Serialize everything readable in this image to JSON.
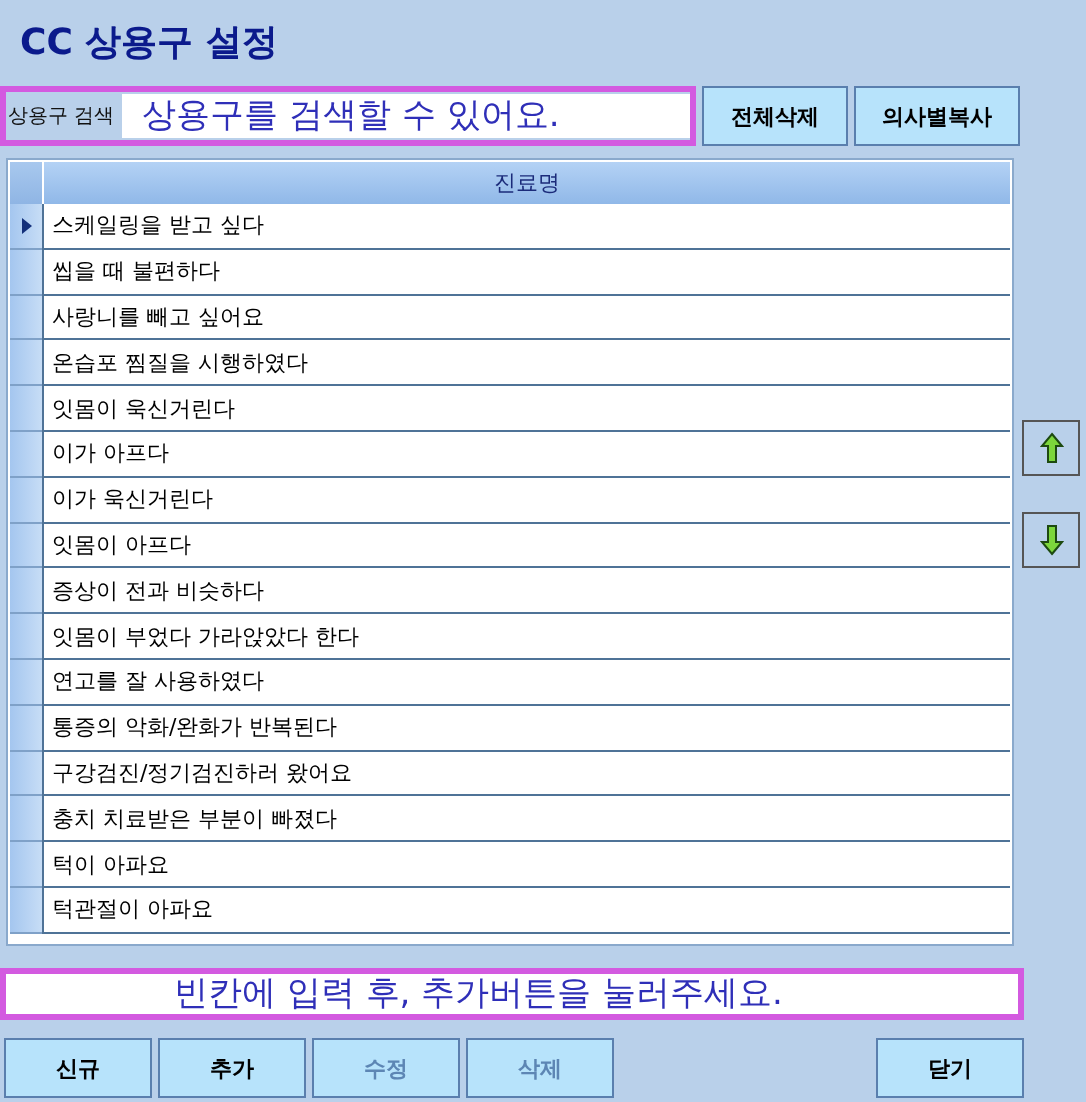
{
  "title": "CC 상용구 설정",
  "search": {
    "label": "상용구 검색",
    "placeholder": "상용구를 검색할 수 있어요."
  },
  "top_buttons": [
    "전체삭제",
    "의사별복사"
  ],
  "table": {
    "columns": [
      "진료명"
    ],
    "rows": [
      {
        "text": "스케일링을 받고 싶다",
        "selected": true
      },
      {
        "text": "씹을 때 불편하다",
        "selected": false
      },
      {
        "text": "사랑니를 빼고 싶어요",
        "selected": false
      },
      {
        "text": "온습포 찜질을 시행하였다",
        "selected": false
      },
      {
        "text": "잇몸이 욱신거린다",
        "selected": false
      },
      {
        "text": "이가 아프다",
        "selected": false
      },
      {
        "text": "이가 욱신거린다",
        "selected": false
      },
      {
        "text": "잇몸이 아프다",
        "selected": false
      },
      {
        "text": "증상이 전과 비슷하다",
        "selected": false
      },
      {
        "text": "잇몸이 부었다 가라앉았다 한다",
        "selected": false
      },
      {
        "text": "연고를 잘 사용하였다",
        "selected": false
      },
      {
        "text": "통증의 악화/완화가 반복된다",
        "selected": false
      },
      {
        "text": "구강검진/정기검진하러 왔어요",
        "selected": false
      },
      {
        "text": "충치 치료받은 부분이 빠졌다",
        "selected": false
      },
      {
        "text": "턱이 아파요",
        "selected": false
      },
      {
        "text": "턱관절이 아파요",
        "selected": false
      }
    ]
  },
  "entry": {
    "placeholder": "빈칸에 입력 후, 추가버튼을 눌러주세요."
  },
  "bottom_buttons": [
    {
      "label": "신규",
      "disabled": false
    },
    {
      "label": "추가",
      "disabled": false
    },
    {
      "label": "수정",
      "disabled": true
    },
    {
      "label": "삭제",
      "disabled": true
    }
  ],
  "close_button": "닫기"
}
